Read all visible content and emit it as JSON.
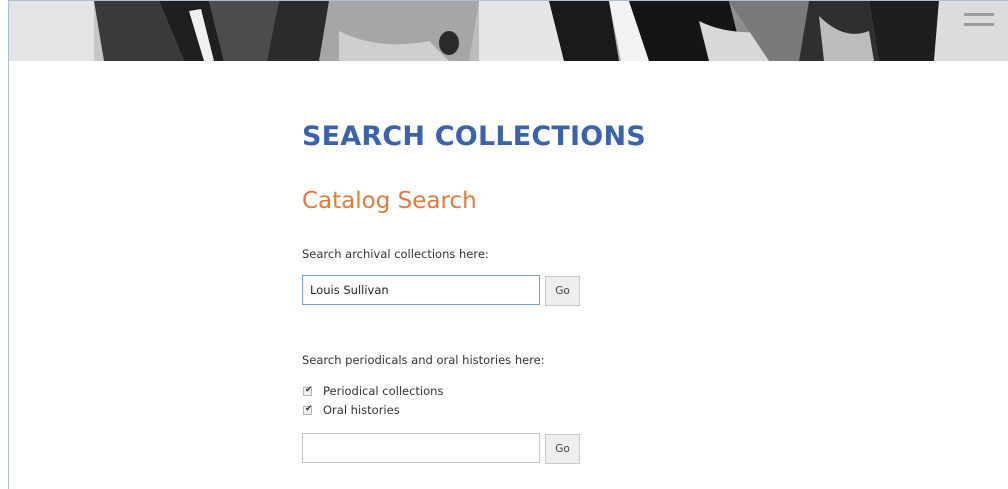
{
  "page": {
    "title": "SEARCH COLLECTIONS",
    "colors": {
      "title": "#3b63ad",
      "section_title": "#e07a3d",
      "focus_border": "#6ea4d8"
    }
  },
  "catalog_search": {
    "heading": "Catalog Search",
    "archival": {
      "label": "Search archival collections here:",
      "input_value": "Louis Sullivan",
      "button_label": "Go"
    },
    "periodicals": {
      "label": "Search periodicals and oral histories here:",
      "options": [
        {
          "label": "Periodical collections",
          "checked": true
        },
        {
          "label": "Oral histories",
          "checked": true
        }
      ],
      "input_value": "",
      "button_label": "Go"
    }
  },
  "icons": {
    "checkmark": "✔"
  }
}
